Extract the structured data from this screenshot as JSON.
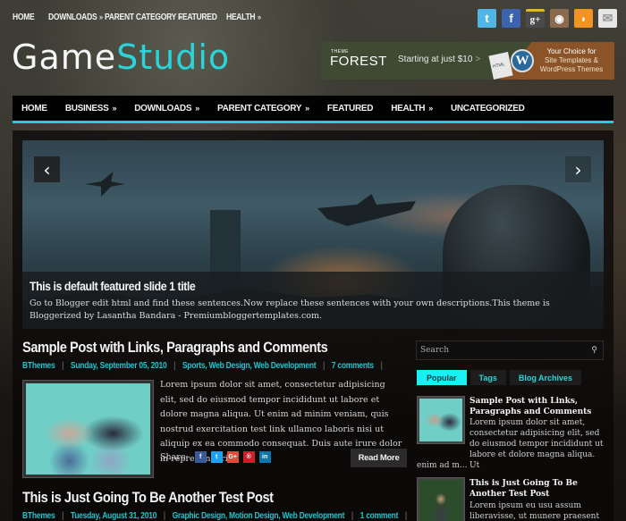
{
  "top_nav": {
    "items": [
      {
        "label": "HOME",
        "has_submenu": false
      },
      {
        "label": "DOWNLOADS",
        "has_submenu": true
      },
      {
        "label": "PARENT CATEGORY",
        "has_submenu": true
      },
      {
        "label": "FEATURED",
        "has_submenu": false
      },
      {
        "label": "HEALTH",
        "has_submenu": true
      }
    ],
    "submenu_glyph": "»"
  },
  "social": [
    {
      "name": "twitter-icon",
      "glyph": "t",
      "color": "#4fb6e6"
    },
    {
      "name": "facebook-icon",
      "glyph": "f",
      "color": "#3b63b0"
    },
    {
      "name": "google-plus-icon",
      "glyph": "g+",
      "color": "#4a4a4a"
    },
    {
      "name": "instagram-icon",
      "glyph": "◉",
      "color": "#8b6a4e"
    },
    {
      "name": "rss-icon",
      "glyph": "◗",
      "color": "#f39322"
    },
    {
      "name": "email-icon",
      "glyph": "✉",
      "color": "#e6e6e6"
    }
  ],
  "logo": {
    "part1": "Game",
    "part2": "Studio",
    "accent_color": "#2ad4d8"
  },
  "ad": {
    "brand_small": "THEME",
    "brand_big": "FOREST",
    "offer": "Starting at just $10",
    "caret": ">",
    "doc_label": "HTML",
    "wp_glyph": "W",
    "tag_line1": "Your Choice for",
    "tag_line2": "Site Templates &",
    "tag_line3": "WordPress Themes"
  },
  "main_nav": {
    "items": [
      {
        "label": "HOME",
        "has_submenu": false
      },
      {
        "label": "BUSINESS",
        "has_submenu": true
      },
      {
        "label": "DOWNLOADS",
        "has_submenu": true
      },
      {
        "label": "PARENT CATEGORY",
        "has_submenu": true
      },
      {
        "label": "FEATURED",
        "has_submenu": false
      },
      {
        "label": "HEALTH",
        "has_submenu": true
      },
      {
        "label": "UNCATEGORIZED",
        "has_submenu": false
      }
    ],
    "accent_color": "#1fd0d6"
  },
  "slider": {
    "prev_glyph": "‹",
    "next_glyph": "›",
    "title": "This is default featured slide 1 title",
    "description": "Go to Blogger edit html and find these sentences.Now replace these sentences with your own descriptions.This theme is Bloggerized by Lasantha Bandara - Premiumbloggertemplates.com."
  },
  "posts": [
    {
      "title": "Sample Post with Links, Paragraphs and Comments",
      "author": "BThemes",
      "date": "Sunday, September 05, 2010",
      "labels": "Sports, Web Design, Web Development",
      "comments": "7 comments",
      "excerpt": "Lorem ipsum dolor sit amet, consectetur adipisicing elit, sed do eiusmod tempor incididunt ut labore et dolore magna aliqua. Ut enim ad minim veniam, quis nostrud exercitation test link ullamco laboris nisi ut aliquip ex ea commodo consequat. Duis aute irure dolor in reprehenderit...",
      "share_label": "Share:",
      "read_more": "Read More"
    },
    {
      "title": "This is Just Going To Be Another Test Post",
      "author": "BThemes",
      "date": "Tuesday, August 31, 2010",
      "labels": "Graphic Design, Motion Design, Web Development",
      "comments": "1 comment"
    }
  ],
  "share_buttons": [
    {
      "name": "facebook-share-icon",
      "glyph": "f",
      "color": "#3b5998"
    },
    {
      "name": "twitter-share-icon",
      "glyph": "t",
      "color": "#1da1f2"
    },
    {
      "name": "google-plus-share-icon",
      "glyph": "G+",
      "color": "#dd4b39"
    },
    {
      "name": "pinterest-share-icon",
      "glyph": "®",
      "color": "#cb2027"
    },
    {
      "name": "linkedin-share-icon",
      "glyph": "in",
      "color": "#0e76a8"
    }
  ],
  "sidebar": {
    "search_placeholder": "Search",
    "search_glyph": "⚲",
    "tabs": [
      {
        "label": "Popular",
        "active": true
      },
      {
        "label": "Tags",
        "active": false
      },
      {
        "label": "Blog Archives",
        "active": false
      }
    ],
    "popular": [
      {
        "title": "Sample Post with Links, Paragraphs and Comments",
        "text_beside": "Lorem ipsum dolor sit amet, consectetur adipisicing elit, sed do eiusmod tempor incididunt ut labore et dolore magna aliqua. Ut",
        "text_below": "enim ad m..."
      },
      {
        "title": "This is Just Going To Be Another Test Post",
        "text_beside": "Lorem ipsum eu usu assum liberavisse, ut munere praesent"
      }
    ]
  }
}
